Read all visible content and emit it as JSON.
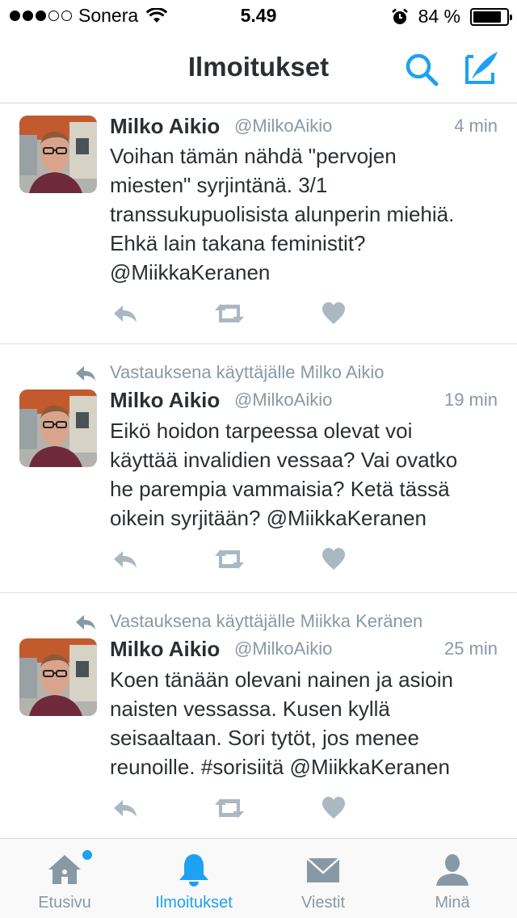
{
  "status_bar": {
    "carrier": "Sonera",
    "signal_bars": "3/5",
    "time": "5.49",
    "battery_text": "84 %",
    "battery_level": 0.84
  },
  "nav": {
    "title": "Ilmoitukset",
    "search_icon": "search-icon",
    "compose_icon": "compose-tweet-icon",
    "accent_color": "#1da1f2"
  },
  "tweets": [
    {
      "name": "Milko Aikio",
      "handle": "@MilkoAikio",
      "time": "4 min",
      "reply_context": "",
      "lines": [
        "Voihan tämän nähdä \"pervojen",
        "miesten\" syrjintänä. 3/1",
        "transsukupuolisista alunperin miehiä.",
        "Ehkä lain takana feministit?",
        "@MiikkaKeranen"
      ]
    },
    {
      "name": "Milko Aikio",
      "handle": "@MilkoAikio",
      "time": "19 min",
      "reply_context": "Vastauksena käyttäjälle Milko Aikio",
      "lines": [
        "Eikö hoidon tarpeessa olevat voi",
        "käyttää invalidien vessaa? Vai ovatko",
        "he parempia vammaisia? Ketä tässä",
        "oikein syrjitään? @MiikkaKeranen"
      ]
    },
    {
      "name": "Milko Aikio",
      "handle": "@MilkoAikio",
      "time": "25 min",
      "reply_context": "Vastauksena käyttäjälle Miikka Keränen",
      "lines": [
        "Koen tänään olevani nainen ja asioin",
        "naisten vessassa. Kusen kyllä",
        "seisaaltaan. Sori tytöt, jos menee",
        "reunoille. #sorisiitä @MiikkaKeranen"
      ]
    }
  ],
  "tabs": [
    {
      "label": "Etusivu",
      "icon": "home-icon",
      "active": false,
      "has_badge": true
    },
    {
      "label": "Ilmoitukset",
      "icon": "bell-icon",
      "active": true,
      "has_badge": false
    },
    {
      "label": "Viestit",
      "icon": "envelope-icon",
      "active": false,
      "has_badge": false
    },
    {
      "label": "Minä",
      "icon": "profile-icon",
      "active": false,
      "has_badge": false
    }
  ],
  "colors": {
    "accent": "#1da1f2",
    "muted": "#8899a6",
    "text": "#292f33",
    "action_icon": "#aab8c2"
  }
}
